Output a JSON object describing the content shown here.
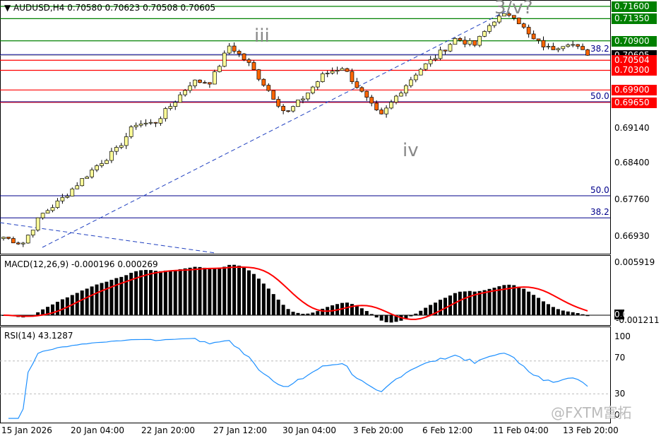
{
  "header": {
    "symbol_line": "AUDUSD,H4  0.70580 0.70623 0.70508 0.70605"
  },
  "macd": {
    "title": "MACD(12,26,9) -0.000196 0.000269",
    "axis": [
      "0.005919",
      "0.00",
      "-0.001211"
    ]
  },
  "rsi": {
    "title": "RSI(14) 43.1287",
    "axis": [
      "100",
      "70",
      "30",
      "0"
    ]
  },
  "price_axis": [
    "0.69140",
    "0.68400",
    "0.67760",
    "0.66930"
  ],
  "price_levels": [
    {
      "label": "0.71600",
      "price": 0.716,
      "color": "#008000"
    },
    {
      "label": "0.71350",
      "price": 0.7135,
      "color": "#008000"
    },
    {
      "label": "0.70900",
      "price": 0.709,
      "color": "#008000"
    },
    {
      "label": "0.70605",
      "price": 0.70605,
      "color": "#000000"
    },
    {
      "label": "0.70504",
      "price": 0.70504,
      "color": "#ff0000"
    },
    {
      "label": "0.70300",
      "price": 0.703,
      "color": "#ff0000"
    },
    {
      "label": "0.69900",
      "price": 0.699,
      "color": "#ff0000"
    },
    {
      "label": "0.69650",
      "price": 0.6965,
      "color": "#ff0000"
    }
  ],
  "fib_levels": [
    {
      "label": "38.2",
      "price": 0.7062
    },
    {
      "label": "50.0",
      "price": 0.6966
    },
    {
      "label": "50.0",
      "price": 0.6775
    },
    {
      "label": "38.2",
      "price": 0.673
    }
  ],
  "waves": [
    "iii",
    "iv",
    "3/v?"
  ],
  "x_labels": [
    "15 Jan 2026",
    "20 Jan 04:00",
    "22 Jan 20:00",
    "27 Jan 12:00",
    "30 Jan 04:00",
    "3 Feb 20:00",
    "6 Feb 12:00",
    "11 Feb 04:00",
    "13 Feb 20:00"
  ],
  "watermark": "@FXTM富拓",
  "chart_data": {
    "type": "candlestick",
    "title": "AUDUSD,H4",
    "ylim": [
      0.6665,
      0.7168
    ],
    "close_keypoints": [
      0.6691,
      0.6677,
      0.6736,
      0.6765,
      0.6802,
      0.6838,
      0.6868,
      0.6922,
      0.6922,
      0.6963,
      0.7007,
      0.7007,
      0.7081,
      0.7044,
      0.6993,
      0.6941,
      0.6978,
      0.7022,
      0.7037,
      0.6985,
      0.6934,
      0.6985,
      0.7029,
      0.7059,
      0.7095,
      0.7081,
      0.7132,
      0.7147,
      0.7095,
      0.7073,
      0.7088,
      0.70605
    ],
    "indicators": [
      "MACD(12,26,9)",
      "RSI(14)"
    ],
    "rsi_levels": [
      70,
      30
    ],
    "colors": {
      "up": "#ffff99",
      "down": "#ff6600",
      "signal": "#ff0000",
      "rsi": "#1e90ff"
    }
  }
}
